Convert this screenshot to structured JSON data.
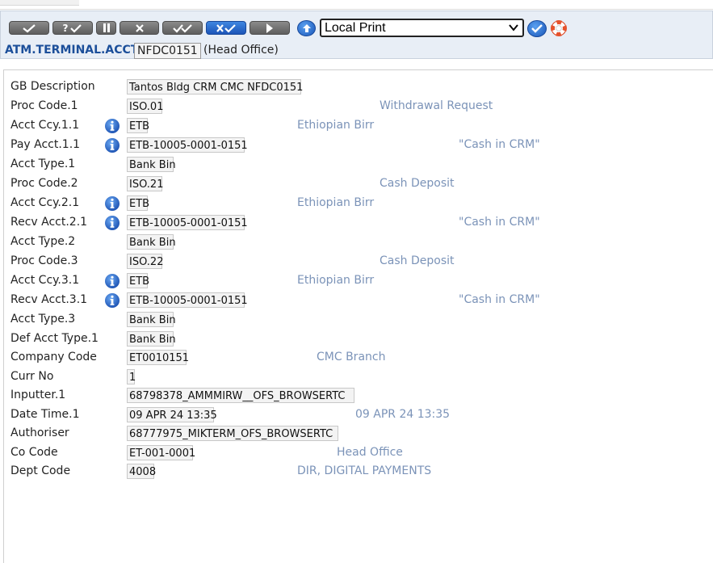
{
  "toolbar": {
    "buttons": [
      {
        "name": "validate-button",
        "icon": "check-icon"
      },
      {
        "name": "hold-button",
        "icon": "question-check-icon",
        "label": "?"
      },
      {
        "name": "pause-button",
        "icon": "pause-icon"
      },
      {
        "name": "delete-button",
        "icon": "x-icon"
      },
      {
        "name": "double-validate-button",
        "icon": "double-check-icon"
      },
      {
        "name": "authorise-button",
        "icon": "x-check-icon"
      },
      {
        "name": "next-button",
        "icon": "play-icon"
      }
    ],
    "print_select": {
      "value": "Local Print"
    },
    "colors": {
      "button": "#6e6e6e",
      "accent": "#1c55b8",
      "header_bg": "#e8eef6"
    }
  },
  "header": {
    "app_title": "ATM.TERMINAL.ACCT",
    "record_id": "NFDC0151",
    "company_suffix": "(Head Office)"
  },
  "fields": [
    {
      "label": "GB Description",
      "value": "Tantos Bldg CRM CMC NFDC0151",
      "info": false,
      "desc": ""
    },
    {
      "label": "Proc Code.1",
      "value": "ISO.01",
      "info": false,
      "desc": "Withdrawal Request"
    },
    {
      "label": "Acct Ccy.1.1",
      "value": "ETB",
      "info": true,
      "desc": "Ethiopian Birr"
    },
    {
      "label": "Pay Acct.1.1",
      "value": "ETB-10005-0001-0151",
      "info": true,
      "desc": "\"Cash in CRM\""
    },
    {
      "label": "Acct Type.1",
      "value": "Bank Bin",
      "info": false,
      "desc": ""
    },
    {
      "label": "Proc Code.2",
      "value": "ISO.21",
      "info": false,
      "desc": "Cash Deposit"
    },
    {
      "label": "Acct Ccy.2.1",
      "value": "ETB",
      "info": true,
      "desc": "Ethiopian Birr"
    },
    {
      "label": "Recv Acct.2.1",
      "value": "ETB-10005-0001-0151",
      "info": true,
      "desc": "\"Cash in CRM\""
    },
    {
      "label": "Acct Type.2",
      "value": "Bank Bin",
      "info": false,
      "desc": ""
    },
    {
      "label": "Proc Code.3",
      "value": "ISO.22",
      "info": false,
      "desc": "Cash Deposit"
    },
    {
      "label": "Acct Ccy.3.1",
      "value": "ETB",
      "info": true,
      "desc": "Ethiopian Birr"
    },
    {
      "label": "Recv Acct.3.1",
      "value": "ETB-10005-0001-0151",
      "info": true,
      "desc": "\"Cash in CRM\""
    },
    {
      "label": "Acct Type.3",
      "value": "Bank Bin",
      "info": false,
      "desc": ""
    },
    {
      "label": "Def Acct Type.1",
      "value": "Bank Bin",
      "info": false,
      "desc": ""
    },
    {
      "label": "Company Code",
      "value": "ET0010151",
      "info": false,
      "desc": "CMC Branch"
    },
    {
      "label": "Curr No",
      "value": "1",
      "info": false,
      "desc": ""
    },
    {
      "label": "Inputter.1",
      "value": "68798378_AMMMIRW__OFS_BROWSERTC",
      "info": false,
      "desc": ""
    },
    {
      "label": "Date Time.1",
      "value": "09 APR 24 13:35",
      "info": false,
      "desc": "09 APR 24 13:35"
    },
    {
      "label": "Authoriser",
      "value": "68777975_MIKTERM_OFS_BROWSERTC",
      "info": false,
      "desc": ""
    },
    {
      "label": "Co Code",
      "value": "ET-001-0001",
      "info": false,
      "desc": "Head Office"
    },
    {
      "label": "Dept Code",
      "value": "4008",
      "info": false,
      "desc": "DIR, DIGITAL PAYMENTS"
    }
  ]
}
